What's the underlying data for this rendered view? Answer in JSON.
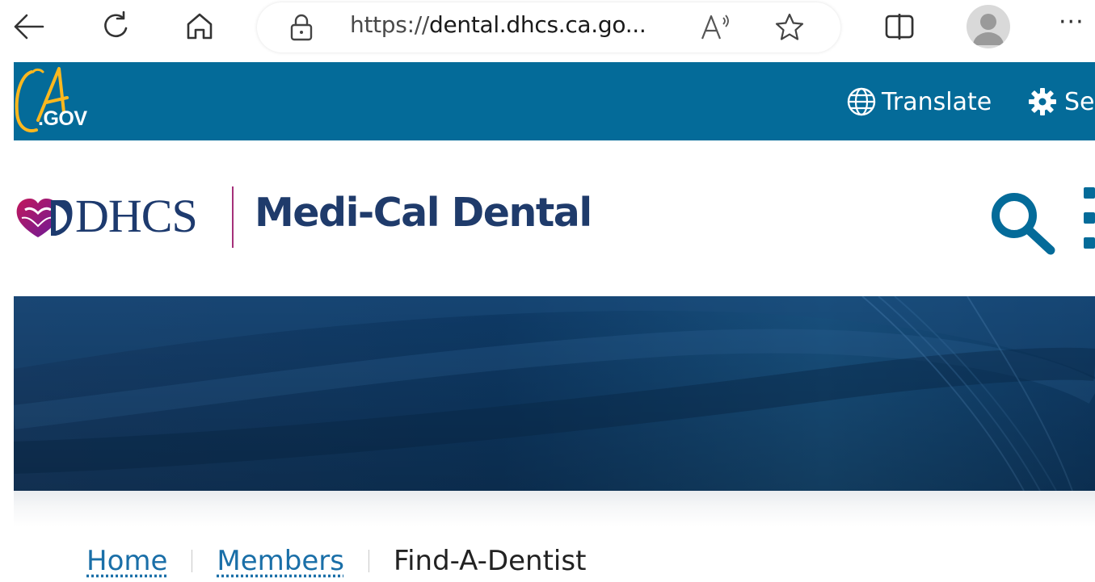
{
  "browser": {
    "url_scheme": "https://",
    "url_host": "dental.dhcs.ca.go...",
    "read_aloud_label": "A¹",
    "more_label": "···",
    "icons": [
      "back-icon",
      "refresh-icon",
      "home-icon",
      "lock-icon",
      "read-aloud-icon",
      "favorite-star-icon",
      "split-screen-icon",
      "profile-avatar",
      "more-icon"
    ]
  },
  "cagov": {
    "logo_text": ".GOV",
    "translate_label": "Translate",
    "settings_label": "Se",
    "bar_color": "#046b99"
  },
  "header": {
    "logo_text": "DHCS",
    "site_title": "Medi-Cal Dental",
    "title_color": "#1f3b6b",
    "accent_color": "#a5307a"
  },
  "breadcrumb": {
    "items": [
      {
        "label": "Home",
        "link": true
      },
      {
        "label": "Members",
        "link": true
      },
      {
        "label": "Find-A-Dentist",
        "link": false
      }
    ]
  }
}
